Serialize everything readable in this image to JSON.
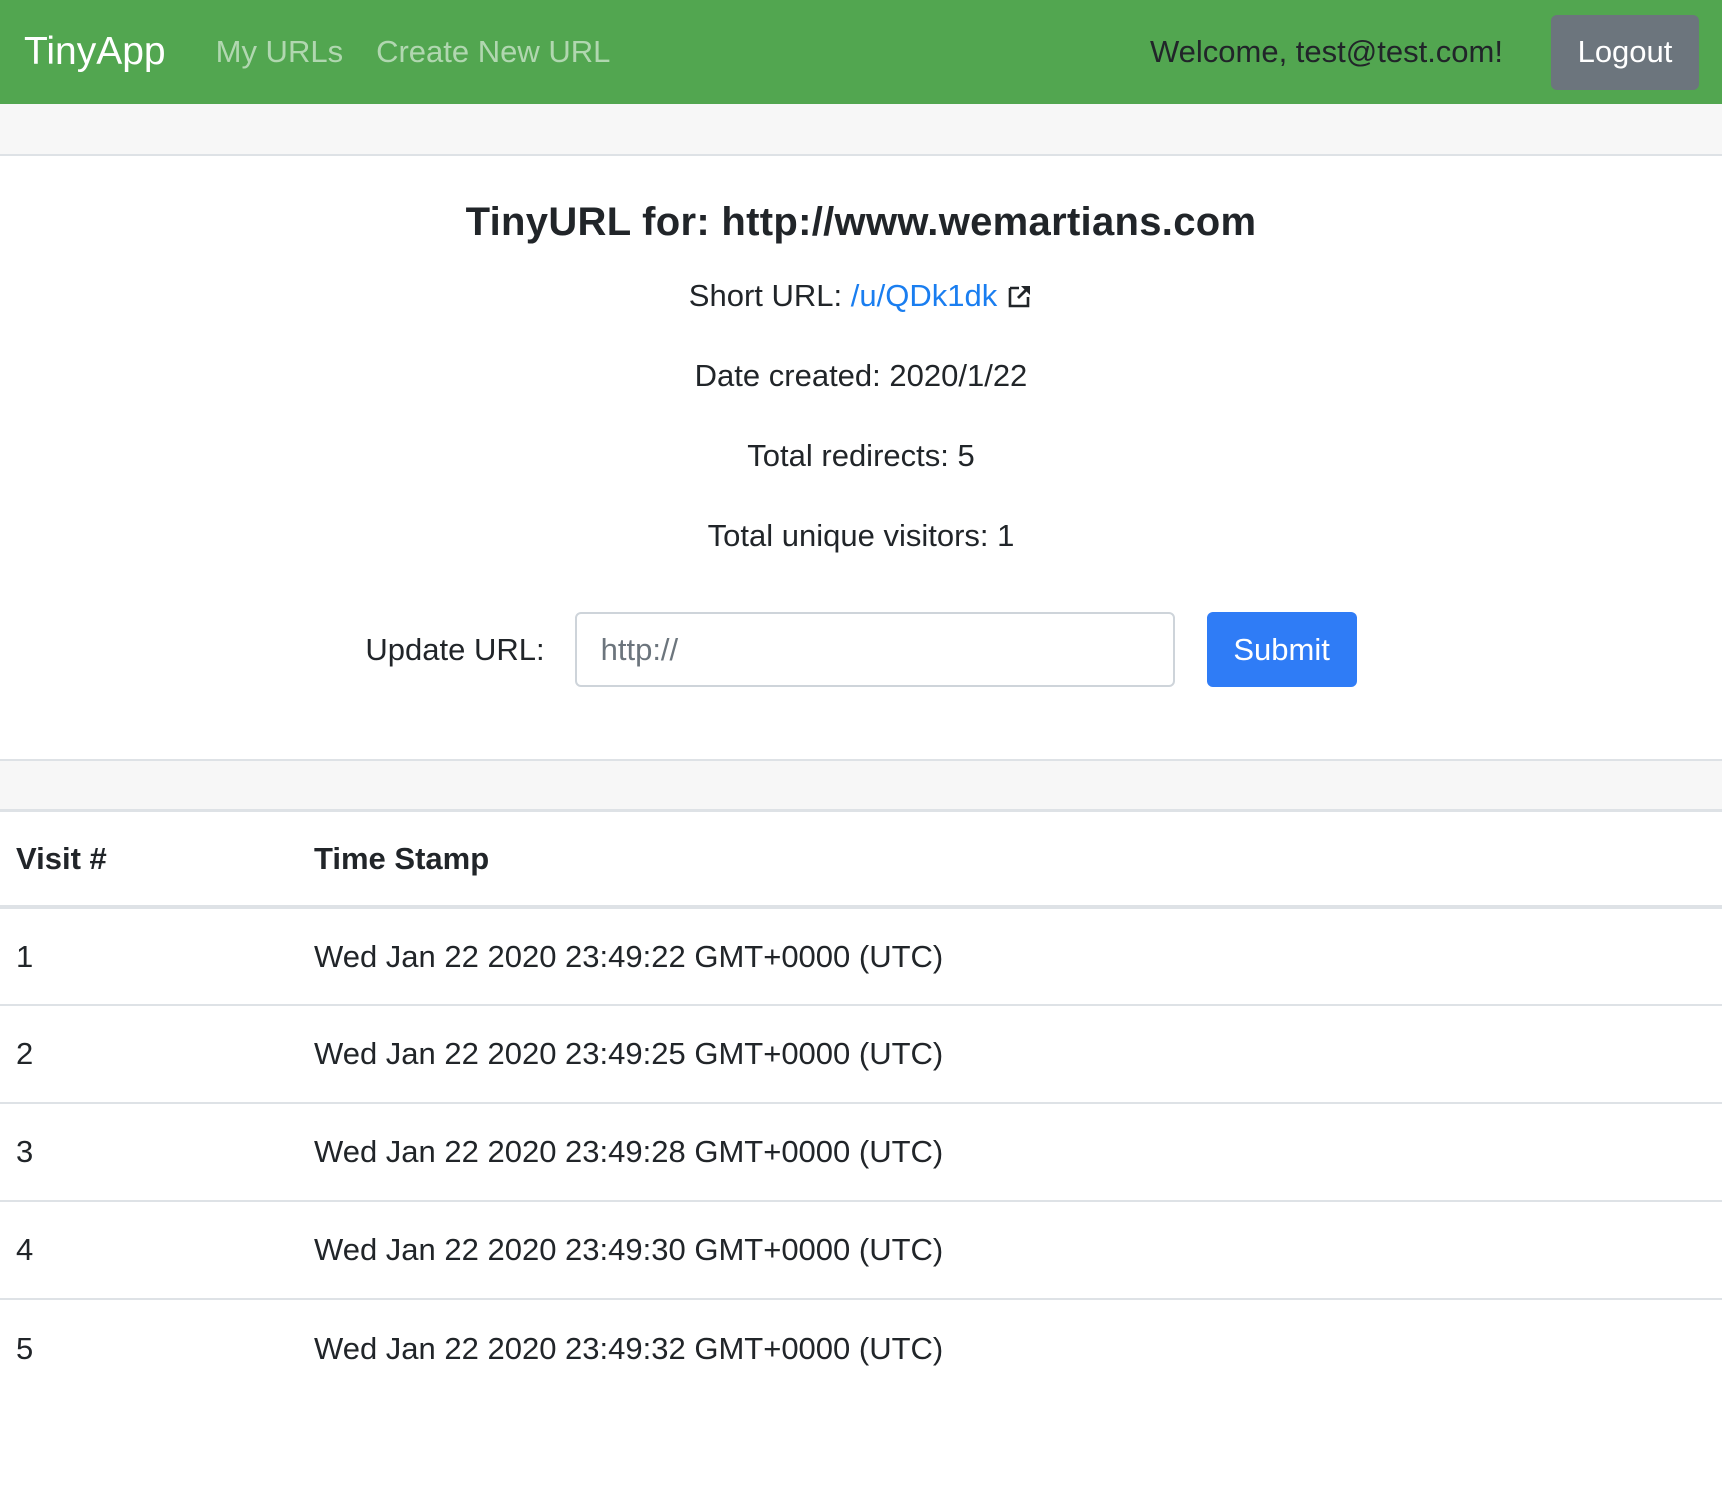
{
  "navbar": {
    "brand": "TinyApp",
    "links": [
      "My URLs",
      "Create New URL"
    ],
    "welcome": "Welcome, test@test.com!",
    "logout_label": "Logout",
    "background_color": "#52a650"
  },
  "card": {
    "title": "TinyURL for: http://www.wemartians.com",
    "short_url_label": "Short URL:",
    "short_url": "/u/QDk1dk",
    "date_created": "Date created: 2020/1/22",
    "total_redirects": "Total redirects: 5",
    "unique_visitors": "Total unique visitors: 1",
    "update_label": "Update URL:",
    "update_placeholder": "http://",
    "submit_label": "Submit",
    "icon": "external-link-icon"
  },
  "visits": {
    "columns": [
      "Visit #",
      "Time Stamp"
    ],
    "rows": [
      {
        "num": "1",
        "time": "Wed Jan 22 2020 23:49:22 GMT+0000 (UTC)"
      },
      {
        "num": "2",
        "time": "Wed Jan 22 2020 23:49:25 GMT+0000 (UTC)"
      },
      {
        "num": "3",
        "time": "Wed Jan 22 2020 23:49:28 GMT+0000 (UTC)"
      },
      {
        "num": "4",
        "time": "Wed Jan 22 2020 23:49:30 GMT+0000 (UTC)"
      },
      {
        "num": "5",
        "time": "Wed Jan 22 2020 23:49:32 GMT+0000 (UTC)"
      }
    ]
  }
}
